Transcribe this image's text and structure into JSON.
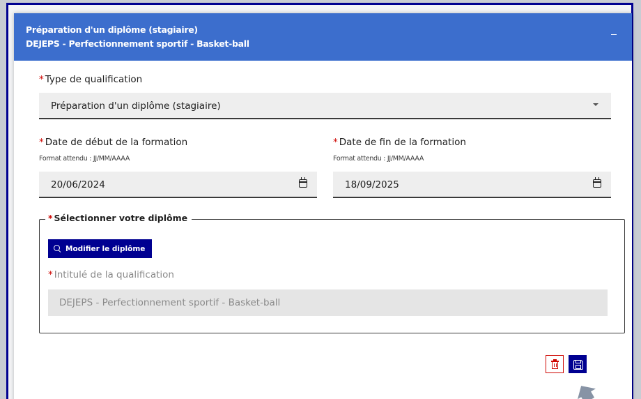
{
  "header": {
    "title_line1": "Préparation d'un diplôme (stagiaire)",
    "title_line2": "DEJEPS - Perfectionnement sportif - Basket-ball",
    "collapse_icon": "minus-icon"
  },
  "qualification_type": {
    "required_mark": "*",
    "label": "Type de qualification",
    "value": "Préparation d'un diplôme (stagiaire)",
    "icon": "chevron-down-icon"
  },
  "start_date": {
    "required_mark": "*",
    "label": "Date de début de la formation",
    "hint": "Format attendu : JJ/MM/AAAA",
    "value": "20/06/2024",
    "icon": "calendar-icon"
  },
  "end_date": {
    "required_mark": "*",
    "label": "Date de fin de la formation",
    "hint": "Format attendu : JJ/MM/AAAA",
    "value": "18/09/2025",
    "icon": "calendar-icon"
  },
  "diploma": {
    "required_mark": "*",
    "legend": "Sélectionner votre diplôme",
    "modify_button": "Modifier le diplôme",
    "qualification_label": "Intitulé de la qualification",
    "qualification_value": "DEJEPS - Perfectionnement sportif - Basket-ball"
  },
  "actions": {
    "delete_icon": "trash-icon",
    "save_icon": "floppy-disk-icon"
  },
  "colors": {
    "header_bg": "#3c6ecd",
    "primary": "#000091",
    "required": "#ce0500",
    "field_bg": "#eeeeee"
  }
}
